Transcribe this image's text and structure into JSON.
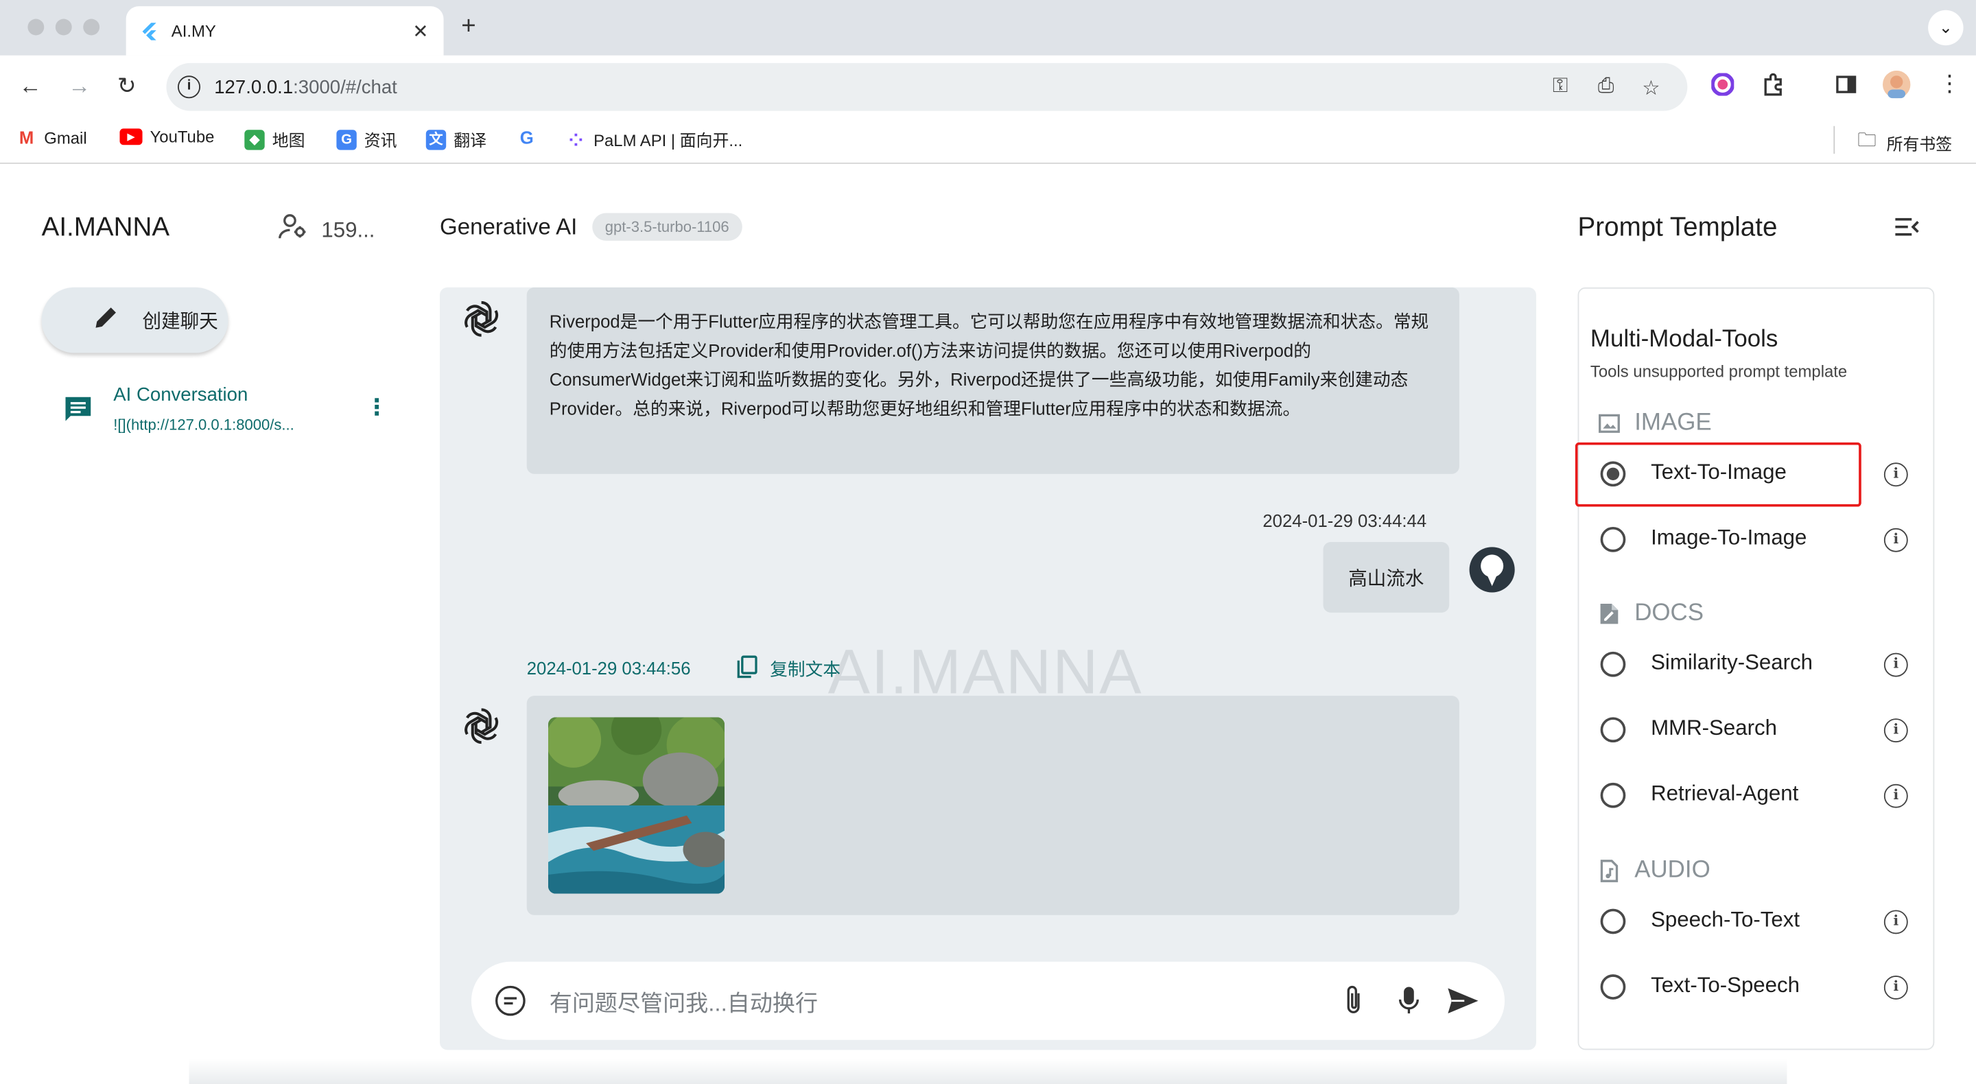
{
  "browser": {
    "tab_title": "AI.MY",
    "new_tab": "+",
    "url_host": "127.0.0.1",
    "url_path": ":3000/#/chat",
    "bookmarks": [
      {
        "label": "Gmail",
        "color": "#ea4335",
        "glyph": "M"
      },
      {
        "label": "YouTube",
        "color": "#ff0000",
        "glyph": "▶"
      },
      {
        "label": "地图",
        "color": "#34a853",
        "glyph": "◆"
      },
      {
        "label": "资讯",
        "color": "#4285f4",
        "glyph": "G"
      },
      {
        "label": "翻译",
        "color": "#4285f4",
        "glyph": "文"
      },
      {
        "label": "",
        "color": "#ffffff",
        "glyph": "G"
      },
      {
        "label": "PaLM API | 面向开...",
        "color": "#7c4dff",
        "glyph": "⁘"
      }
    ],
    "all_bookmarks": "所有书签"
  },
  "sidebar": {
    "brand": "AI.MANNA",
    "user_count": "159...",
    "new_chat_label": "创建聊天",
    "conversation": {
      "title": "AI Conversation",
      "snippet": "![](http://127.0.0.1:8000/s..."
    }
  },
  "chat": {
    "title": "Generative AI",
    "model": "gpt-3.5-turbo-1106",
    "watermark": "AI.MANNA",
    "messages": {
      "assistant_text": "Riverpod是一个用于Flutter应用程序的状态管理工具。它可以帮助您在应用程序中有效地管理数据流和状态。常规的使用方法包括定义Provider和使用Provider.of()方法来访问提供的数据。您还可以使用Riverpod的ConsumerWidget来订阅和监听数据的变化。另外，Riverpod还提供了一些高级功能，如使用Family来创建动态Provider。总的来说，Riverpod可以帮助您更好地组织和管理Flutter应用程序中的状态和数据流。",
      "user_time": "2024-01-29 03:44:44",
      "user_text": "高山流水",
      "assistant_time": "2024-01-29 03:44:56",
      "copy_label": "复制文本"
    },
    "input_placeholder": "有问题尽管问我...自动换行"
  },
  "prompt_panel": {
    "title": "Prompt Template",
    "card_title": "Multi-Modal-Tools",
    "card_subtitle": "Tools unsupported prompt template",
    "sections": {
      "image": "IMAGE",
      "docs": "DOCS",
      "audio": "AUDIO"
    },
    "options": {
      "text_to_image": "Text-To-Image",
      "image_to_image": "Image-To-Image",
      "similarity_search": "Similarity-Search",
      "mmr_search": "MMR-Search",
      "retrieval_agent": "Retrieval-Agent",
      "speech_to_text": "Speech-To-Text",
      "text_to_speech": "Text-To-Speech"
    },
    "selected": "Text-To-Image"
  },
  "colors": {
    "accent": "#0e6b6b",
    "highlight": "#e81b1b",
    "bubble": "#d8dee2",
    "panel": "#ebeff2"
  }
}
